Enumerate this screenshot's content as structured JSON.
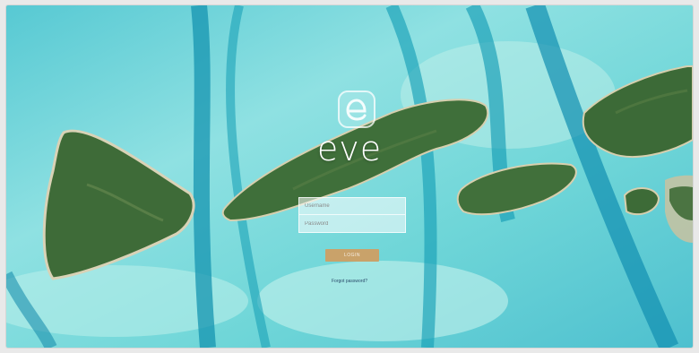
{
  "app": {
    "brand_name": "eve",
    "logo_icon": "eve-logo-icon"
  },
  "login": {
    "username_placeholder": "Username",
    "password_placeholder": "Password",
    "login_label": "LOGIN",
    "forgot_label": "Forgot password?"
  },
  "colors": {
    "login_button": "#c9a26a",
    "sea": "#66cfd6",
    "channel": "#179db4",
    "island": "#3f6f3a"
  }
}
